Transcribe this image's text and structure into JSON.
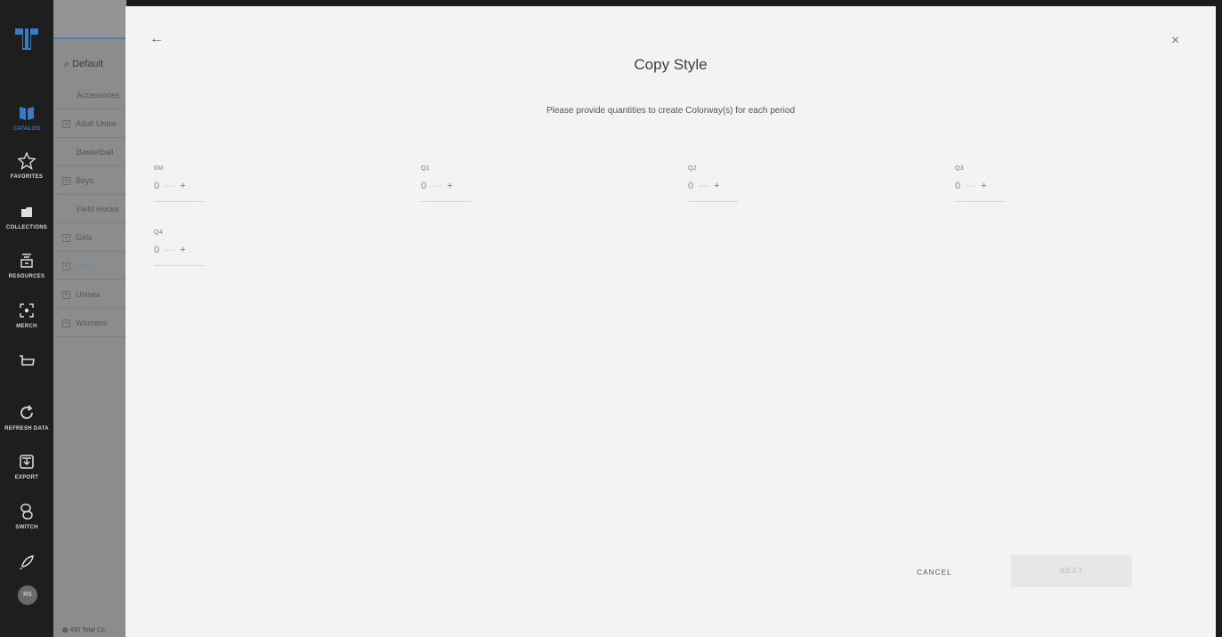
{
  "rail": {
    "items": [
      {
        "name": "catalog",
        "label": "CATALOG",
        "icon": "book-icon"
      },
      {
        "name": "favorites",
        "label": "FAVORITES",
        "icon": "star-icon"
      },
      {
        "name": "collections",
        "label": "COLLECTIONS",
        "icon": "folder-icon"
      },
      {
        "name": "resources",
        "label": "RESOURCES",
        "icon": "resources-icon"
      },
      {
        "name": "merch",
        "label": "MERCH",
        "icon": "merch-icon"
      },
      {
        "name": "cart",
        "label": "",
        "icon": "cart-icon"
      },
      {
        "name": "refresh",
        "label": "REFRESH DATA",
        "icon": "refresh-icon"
      },
      {
        "name": "export",
        "label": "EXPORT",
        "icon": "export-icon"
      },
      {
        "name": "switch",
        "label": "SWITCH",
        "icon": "switch-icon"
      },
      {
        "name": "rocket",
        "label": "",
        "icon": "rocket-icon"
      }
    ],
    "avatar": "RS"
  },
  "catalog": {
    "search_label": "Default",
    "items": [
      {
        "label": "Accessories",
        "expandable": false
      },
      {
        "label": "Adult Unise",
        "expandable": true
      },
      {
        "label": "Basketball",
        "expandable": false
      },
      {
        "label": "Boys",
        "expandable": true
      },
      {
        "label": "Field Hocke",
        "expandable": false
      },
      {
        "label": "Girls",
        "expandable": true
      },
      {
        "label": "Mens",
        "expandable": true
      },
      {
        "label": "Unisex",
        "expandable": true
      },
      {
        "label": "Womens",
        "expandable": true
      }
    ],
    "footer": "430 Total Co"
  },
  "modal": {
    "title": "Copy Style",
    "subtitle": "Please provide quantities to create Colorway(s) for each period",
    "periods": [
      {
        "label": "6M",
        "value": "0"
      },
      {
        "label": "Q1",
        "value": "0"
      },
      {
        "label": "Q2",
        "value": "0"
      },
      {
        "label": "Q3",
        "value": "0"
      },
      {
        "label": "Q4",
        "value": "0"
      }
    ],
    "minus": "—",
    "plus": "+",
    "cancel_label": "CANCEL",
    "next_label": "NEXT",
    "back_arrow": "←",
    "close_x": "×"
  },
  "colors": {
    "accent": "#3b7bc4",
    "modal_bg": "#f3f3f3",
    "rail_bg": "#1e1e1e"
  }
}
